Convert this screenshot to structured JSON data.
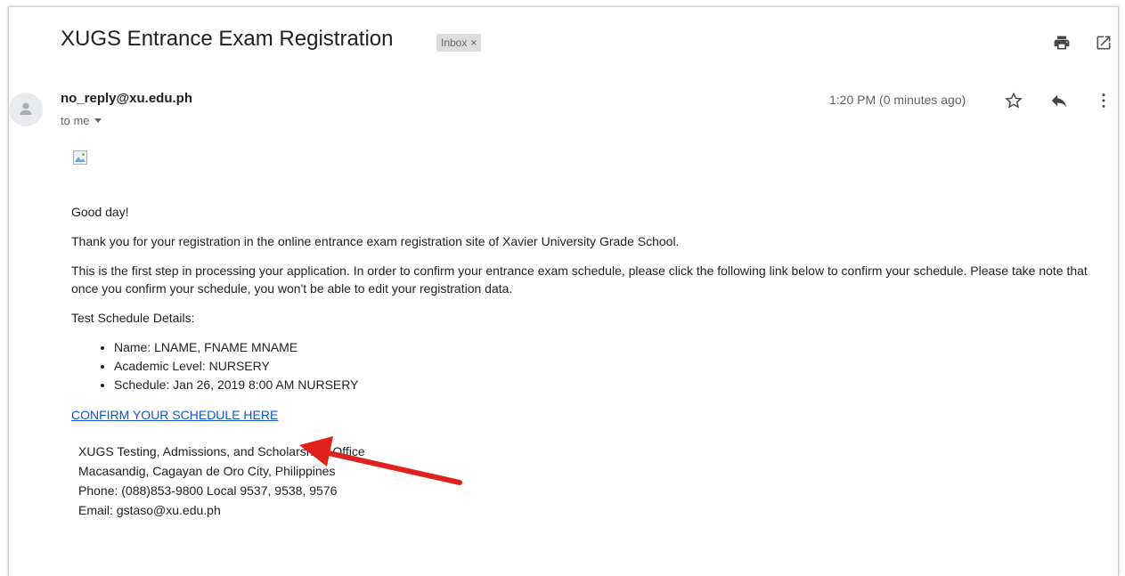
{
  "email": {
    "subject": "XUGS Entrance Exam Registration",
    "label": "Inbox",
    "label_close": "×",
    "sender": "no_reply@xu.edu.ph",
    "to": "to me",
    "time": "1:20 PM (0 minutes ago)",
    "greeting": "Good day!",
    "para1": "Thank you for your registration in the online entrance exam registration site of Xavier University Grade School.",
    "para2": "This is the first step in processing your application. In order to confirm your entrance exam schedule, please click the following link below to confirm your schedule. Please take note that once you confirm your schedule, you won't be able to edit your registration data.",
    "details_heading": "Test Schedule Details:",
    "details": [
      "Name: LNAME, FNAME MNAME",
      "Academic Level: NURSERY",
      "Schedule: Jan 26, 2019 8:00 AM NURSERY"
    ],
    "confirm_link": "CONFIRM YOUR SCHEDULE HERE",
    "signature": [
      "XUGS Testing, Admissions, and Scholarships Office",
      "Macasandig, Cagayan de Oro City, Philippines",
      "Phone: (088)853-9800 Local 9537, 9538, 9576",
      "Email: gstaso@xu.edu.ph"
    ]
  },
  "icons": {
    "print": "print-icon",
    "open_new_window": "open-in-new-window-icon",
    "star": "star-icon",
    "reply": "reply-icon",
    "more": "more-vertical-icon",
    "avatar": "person-icon",
    "dropdown": "caret-down-icon",
    "broken_image": "broken-image-icon",
    "annotation_arrow": "red-arrow-annotation"
  },
  "colors": {
    "link": "#1155cc",
    "arrow": "#e0201c",
    "chip_bg": "#dddddd"
  }
}
